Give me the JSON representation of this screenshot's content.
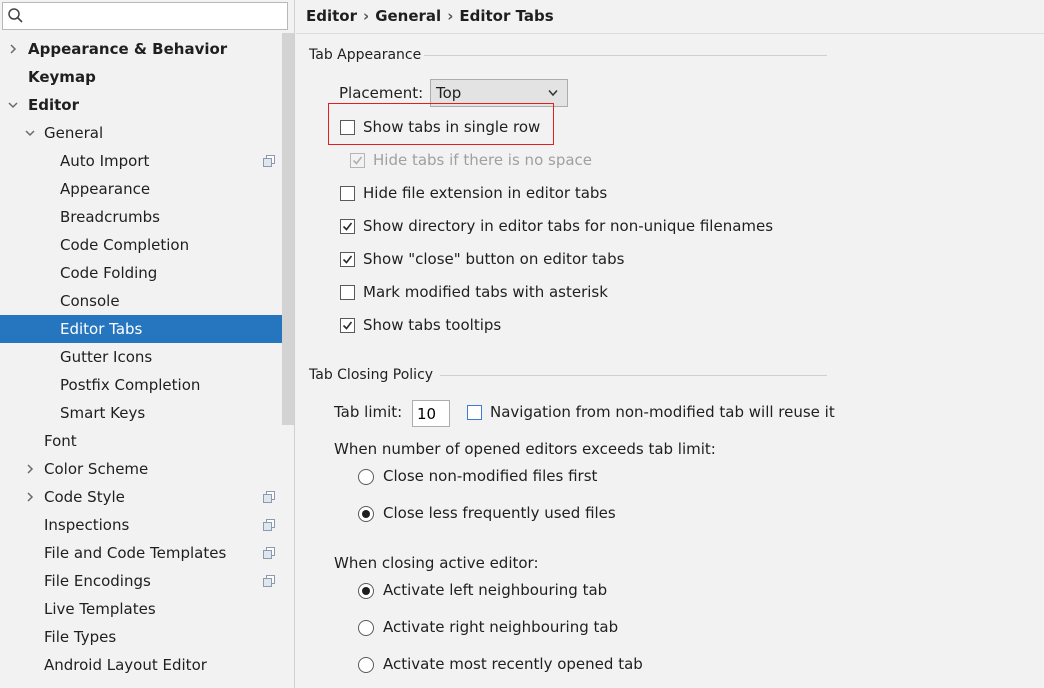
{
  "search": {
    "placeholder": "",
    "value": ""
  },
  "tree": [
    {
      "label": "Appearance & Behavior",
      "bold": true,
      "arrow": "right"
    },
    {
      "label": "Keymap",
      "bold": true
    },
    {
      "label": "Editor",
      "bold": true,
      "arrow": "down"
    },
    {
      "label": "General",
      "arrow": "down"
    },
    {
      "label": "Auto Import",
      "icon": "page-icon"
    },
    {
      "label": "Appearance"
    },
    {
      "label": "Breadcrumbs"
    },
    {
      "label": "Code Completion"
    },
    {
      "label": "Code Folding"
    },
    {
      "label": "Console"
    },
    {
      "label": "Editor Tabs",
      "selected": true
    },
    {
      "label": "Gutter Icons"
    },
    {
      "label": "Postfix Completion"
    },
    {
      "label": "Smart Keys"
    },
    {
      "label": "Font"
    },
    {
      "label": "Color Scheme",
      "arrow": "right"
    },
    {
      "label": "Code Style",
      "arrow": "right",
      "icon": "page-icon"
    },
    {
      "label": "Inspections",
      "icon": "page-icon"
    },
    {
      "label": "File and Code Templates",
      "icon": "page-icon"
    },
    {
      "label": "File Encodings",
      "icon": "page-icon"
    },
    {
      "label": "Live Templates"
    },
    {
      "label": "File Types"
    },
    {
      "label": "Android Layout Editor"
    }
  ],
  "breadcrumb": {
    "part1": "Editor",
    "part2": "General",
    "part3": "Editor Tabs",
    "sep": "›"
  },
  "tab_appearance": {
    "title": "Tab Appearance",
    "placement_label": "Placement:",
    "placement_value": "Top",
    "options": [
      {
        "label": "Show tabs in single row",
        "checked": false,
        "disabled": false
      },
      {
        "label": "Hide tabs if there is no space",
        "checked": true,
        "disabled": true
      },
      {
        "label": "Hide file extension in editor tabs",
        "checked": false,
        "disabled": false
      },
      {
        "label": "Show directory in editor tabs for non-unique filenames",
        "checked": true,
        "disabled": false
      },
      {
        "label": "Show \"close\" button on editor tabs",
        "checked": true,
        "disabled": false
      },
      {
        "label": "Mark modified tabs with asterisk",
        "checked": false,
        "disabled": false
      },
      {
        "label": "Show tabs tooltips",
        "checked": true,
        "disabled": false
      }
    ]
  },
  "tab_closing": {
    "title": "Tab Closing Policy",
    "tab_limit_label": "Tab limit:",
    "tab_limit_value": "10",
    "nav_reuse_label": "Navigation from non-modified tab will reuse it",
    "nav_reuse_checked": false,
    "exceeds_label": "When number of opened editors exceeds tab limit:",
    "exceeds_options": [
      {
        "label": "Close non-modified files first",
        "selected": false
      },
      {
        "label": "Close less frequently used files",
        "selected": true
      }
    ],
    "closing_label": "When closing active editor:",
    "closing_options": [
      {
        "label": "Activate left neighbouring tab",
        "selected": true
      },
      {
        "label": "Activate right neighbouring tab",
        "selected": false
      },
      {
        "label": "Activate most recently opened tab",
        "selected": false
      }
    ]
  },
  "colors": {
    "selection": "#2675bf",
    "highlight_border": "#e02020",
    "accent_checkbox": "#3e7bd6"
  }
}
